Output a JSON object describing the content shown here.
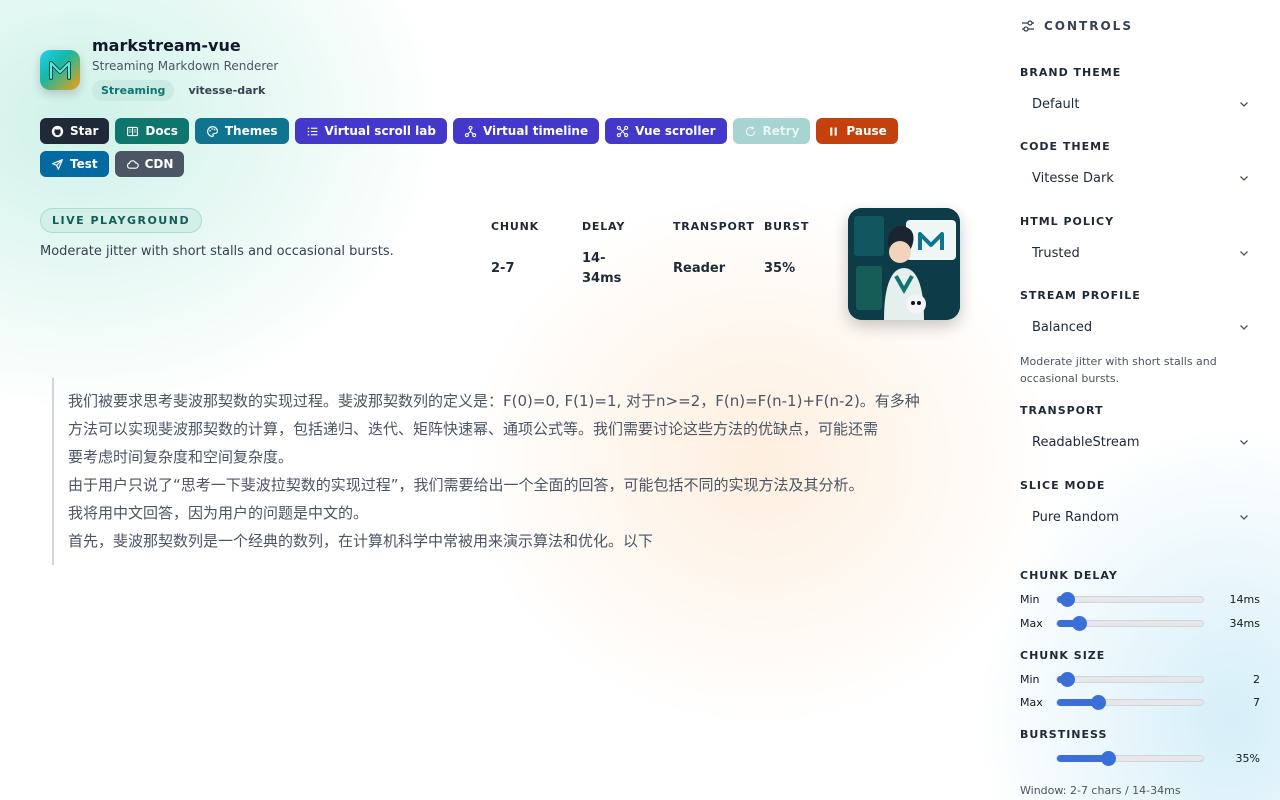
{
  "header": {
    "title": "markstream-vue",
    "subtitle": "Streaming Markdown Renderer",
    "status_badge": "Streaming",
    "theme_badge": "vitesse-dark"
  },
  "toolbar": {
    "star": "Star",
    "docs": "Docs",
    "themes": "Themes",
    "virtual_scroll_lab": "Virtual scroll lab",
    "virtual_timeline": "Virtual timeline",
    "vue_scroller": "Vue scroller",
    "retry": "Retry",
    "pause": "Pause",
    "test": "Test",
    "cdn": "CDN"
  },
  "playground": {
    "badge": "LIVE PLAYGROUND",
    "description": "Moderate jitter with short stalls and occasional bursts.",
    "stats": [
      {
        "label": "CHUNK",
        "value": "2-7"
      },
      {
        "label": "DELAY",
        "value": "14-34ms"
      },
      {
        "label": "TRANSPORT",
        "value": "Reader"
      },
      {
        "label": "BURST",
        "value": "35%"
      }
    ]
  },
  "stream": {
    "lines": [
      "我们被要求思考斐波那契数的实现过程。斐波那契数列的定义是：F(0)=0, F(1)=1, 对于n>=2，F(n)=F(n-1)+F(n-2)。有多种",
      "方法可以实现斐波那契数的计算，包括递归、迭代、矩阵快速幂、通项公式等。我们需要讨论这些方法的优缺点，可能还需",
      "要考虑时间复杂度和空间复杂度。",
      "由于用户只说了“思考一下斐波拉契数的实现过程”，我们需要给出一个全面的回答，可能包括不同的实现方法及其分析。",
      "我将用中文回答，因为用户的问题是中文的。",
      "首先，斐波那契数列是一个经典的数列，在计算机科学中常被用来演示算法和优化。以下"
    ]
  },
  "sidebar": {
    "heading": "CONTROLS",
    "brand_theme": {
      "label": "BRAND THEME",
      "value": "Default"
    },
    "code_theme": {
      "label": "CODE THEME",
      "value": "Vitesse Dark"
    },
    "html_policy": {
      "label": "HTML POLICY",
      "value": "Trusted"
    },
    "stream_profile": {
      "label": "STREAM PROFILE",
      "value": "Balanced",
      "note": "Moderate jitter with short stalls and occasional bursts."
    },
    "transport": {
      "label": "TRANSPORT",
      "value": "ReadableStream"
    },
    "slice_mode": {
      "label": "SLICE MODE",
      "value": "Pure Random"
    },
    "chunk_delay": {
      "label": "CHUNK DELAY",
      "min_label": "Min",
      "min_value": "14ms",
      "min_fraction": 0.07,
      "max_label": "Max",
      "max_value": "34ms",
      "max_fraction": 0.15
    },
    "chunk_size": {
      "label": "CHUNK SIZE",
      "min_label": "Min",
      "min_value": "2",
      "min_fraction": 0.07,
      "max_label": "Max",
      "max_value": "7",
      "max_fraction": 0.28
    },
    "burstiness": {
      "label": "BURSTINESS",
      "value": "35%",
      "fraction": 0.35
    },
    "window_note": "Window: 2-7 chars / 14-34ms"
  },
  "colors": {
    "accent": "#3b6fd8",
    "teal": "#0f766e",
    "indigo": "#4338ca",
    "orange": "#c2410c"
  }
}
